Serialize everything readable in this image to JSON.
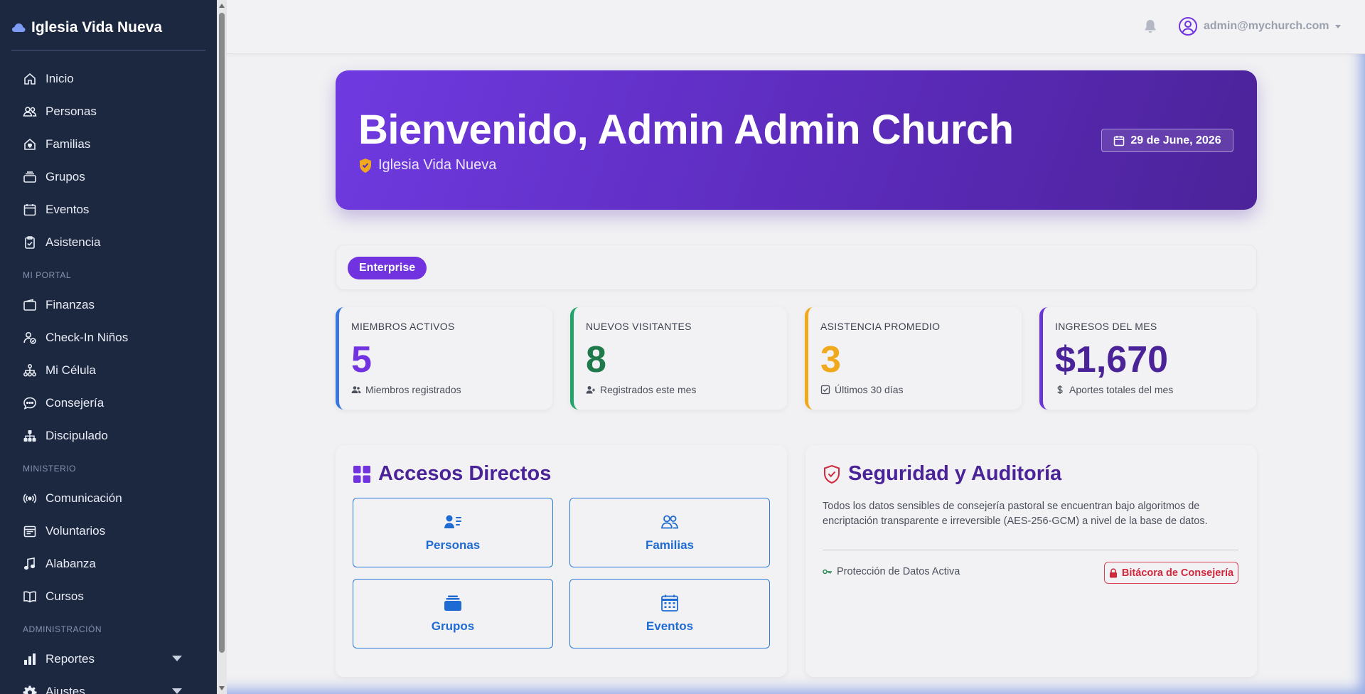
{
  "sidebar": {
    "brand": "Iglesia Vida Nueva",
    "items": [
      {
        "label": "Inicio"
      },
      {
        "label": "Personas"
      },
      {
        "label": "Familias"
      },
      {
        "label": "Grupos"
      },
      {
        "label": "Eventos"
      },
      {
        "label": "Asistencia"
      }
    ],
    "section_portal": "MI PORTAL",
    "portal_items": [
      {
        "label": "Finanzas"
      },
      {
        "label": "Check-In Niños"
      },
      {
        "label": "Mi Célula"
      },
      {
        "label": "Consejería"
      },
      {
        "label": "Discipulado"
      }
    ],
    "section_ministry": "MINISTERIO",
    "ministry_items": [
      {
        "label": "Comunicación"
      },
      {
        "label": "Voluntarios"
      },
      {
        "label": "Alabanza"
      },
      {
        "label": "Cursos"
      }
    ],
    "section_admin": "ADMINISTRACIÓN",
    "admin_items": [
      {
        "label": "Reportes"
      },
      {
        "label": "Ajustes"
      }
    ]
  },
  "topbar": {
    "user_email": "admin@mychurch.com"
  },
  "hero": {
    "title": "Bienvenido, Admin Admin Church",
    "church": "Iglesia Vida Nueva",
    "date": "29 de June, 2026"
  },
  "plan": {
    "badge": "Enterprise"
  },
  "stats": [
    {
      "label": "MIEMBROS ACTIVOS",
      "value": "5",
      "note": "Miembros registrados",
      "color": "#7033df",
      "border": "#3b76e0"
    },
    {
      "label": "NUEVOS VISITANTES",
      "value": "8",
      "note": "Registrados este mes",
      "color": "#1e7a4a",
      "border": "#22a36a"
    },
    {
      "label": "ASISTENCIA PROMEDIO",
      "value": "3",
      "note": "Últimos 30 días",
      "color": "#f0a81c",
      "border": "#f0a81c"
    },
    {
      "label": "INGRESOS DEL MES",
      "value": "$1,670",
      "note": "Aportes totales del mes",
      "color": "#4b2399",
      "border": "#6a35d6"
    }
  ],
  "quick_access": {
    "title": "Accesos Directos",
    "buttons": [
      {
        "label": "Personas"
      },
      {
        "label": "Familias"
      },
      {
        "label": "Grupos"
      },
      {
        "label": "Eventos"
      }
    ]
  },
  "security": {
    "title": "Seguridad y Auditoría",
    "text": "Todos los datos sensibles de consejería pastoral se encuentran bajo algoritmos de encriptación transparente e irreversible (AES-256-GCM) a nivel de la base de datos.",
    "status": "Protección de Datos Activa",
    "button": "Bitácora de Consejería"
  },
  "colors": {
    "sidebar_bg": "#1c2740",
    "accent": "#7033df",
    "hero_start": "#6f3ae0",
    "hero_end": "#4c2399",
    "link_blue": "#1f6bd4",
    "danger": "#d0283d"
  }
}
